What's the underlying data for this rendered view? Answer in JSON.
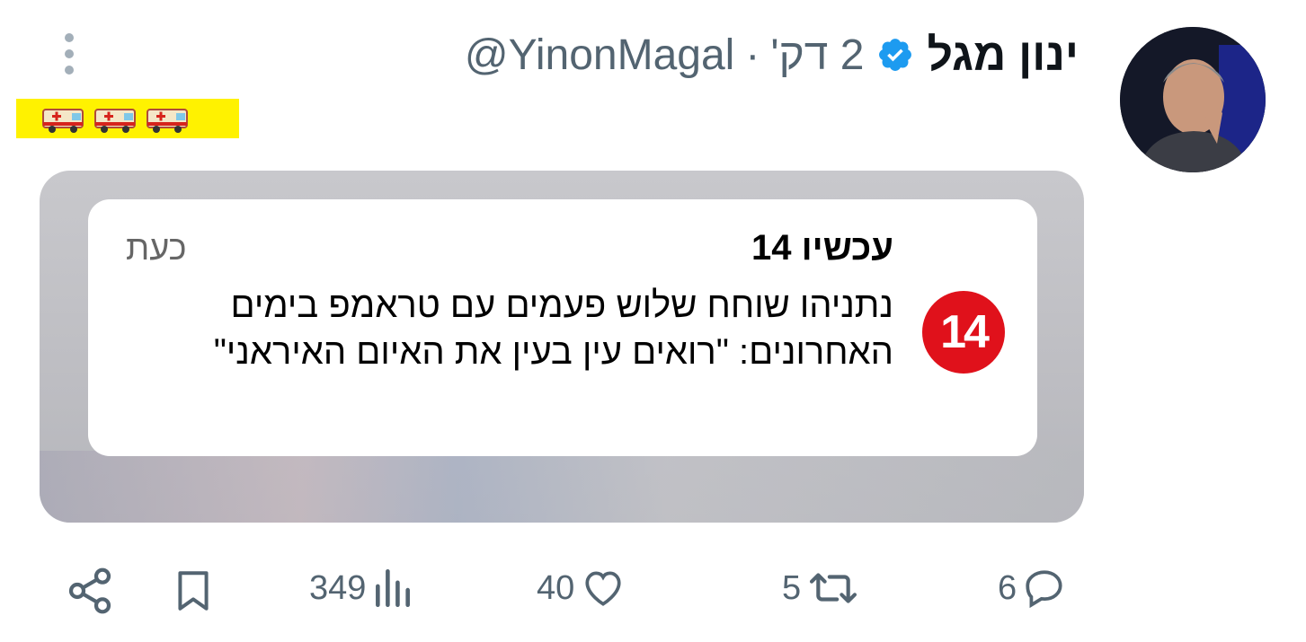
{
  "tweet": {
    "display_name": "ינון מגל",
    "handle": "@YinonMagal",
    "separator": "·",
    "time": "2 דק'",
    "emoji_text": "🚑🚑🚑"
  },
  "notification": {
    "source": "עכשיו 14",
    "time": "כעת",
    "logo_text": "14",
    "headline": "נתניהו שוחח שלוש פעמים עם טראמפ בימים האחרונים: \"רואים עין בעין את האיום האיראני\""
  },
  "actions": {
    "replies": "6",
    "retweets": "5",
    "likes": "40",
    "views": "349"
  },
  "colors": {
    "accent": "#1d9bf0",
    "muted": "#536471",
    "logo_red": "#e0111b",
    "highlight": "#fff200"
  },
  "icons": [
    "more-vertical-icon",
    "verified-badge-icon",
    "ambulance-icon",
    "reply-icon",
    "retweet-icon",
    "like-icon",
    "views-icon",
    "bookmark-icon",
    "share-icon"
  ]
}
